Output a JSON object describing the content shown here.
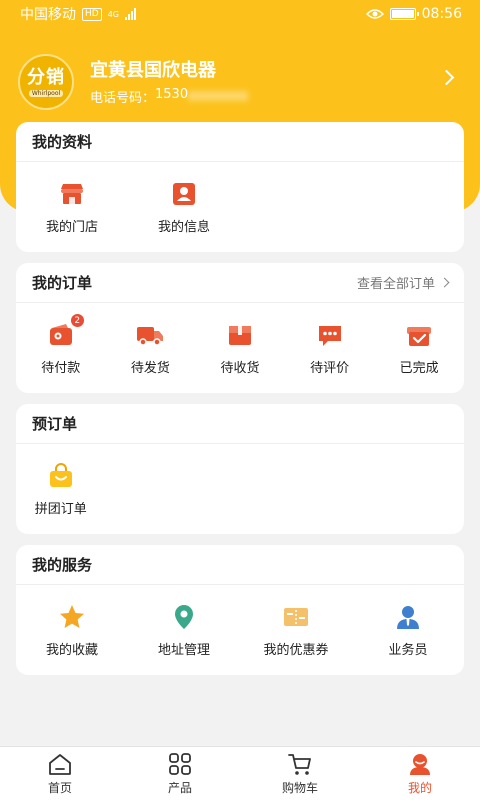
{
  "status_bar": {
    "carrier": "中国移动",
    "network_badge": "HD",
    "network_type": "4G",
    "time": "08:56",
    "eye_icon": "eye-icon",
    "battery_level": 1.0
  },
  "store": {
    "logo_text": "分销",
    "logo_subtext": "Whirlpool",
    "name": "宜黄县国欣电器",
    "phone_prefix": "电话号码：",
    "phone_visible": "1530"
  },
  "profile_section": {
    "title": "我的资料",
    "items": [
      {
        "label": "我的门店",
        "icon": "store-icon"
      },
      {
        "label": "我的信息",
        "icon": "id-card-icon"
      }
    ]
  },
  "orders_section": {
    "title": "我的订单",
    "view_all": "查看全部订单",
    "items": [
      {
        "label": "待付款",
        "icon": "wallet-icon",
        "badge": "2"
      },
      {
        "label": "待发货",
        "icon": "truck-icon"
      },
      {
        "label": "待收货",
        "icon": "package-icon"
      },
      {
        "label": "待评价",
        "icon": "comment-icon"
      },
      {
        "label": "已完成",
        "icon": "completed-box-icon"
      }
    ]
  },
  "preorder_section": {
    "title": "预订单",
    "items": [
      {
        "label": "拼团订单",
        "icon": "shopping-bag-icon"
      }
    ]
  },
  "services_section": {
    "title": "我的服务",
    "items": [
      {
        "label": "我的收藏",
        "icon": "star-icon"
      },
      {
        "label": "地址管理",
        "icon": "location-pin-icon"
      },
      {
        "label": "我的优惠券",
        "icon": "coupon-icon"
      },
      {
        "label": "业务员",
        "icon": "salesperson-icon"
      }
    ]
  },
  "tab_bar": {
    "active_tab": "我的",
    "tabs": [
      {
        "label": "首页",
        "icon": "home-icon"
      },
      {
        "label": "产品",
        "icon": "grid-icon"
      },
      {
        "label": "购物车",
        "icon": "cart-icon"
      },
      {
        "label": "我的",
        "icon": "user-icon"
      }
    ]
  },
  "colors": {
    "brand_yellow": "#fcc21b",
    "accent_red": "#e9522e",
    "background": "#f2f2f2"
  }
}
